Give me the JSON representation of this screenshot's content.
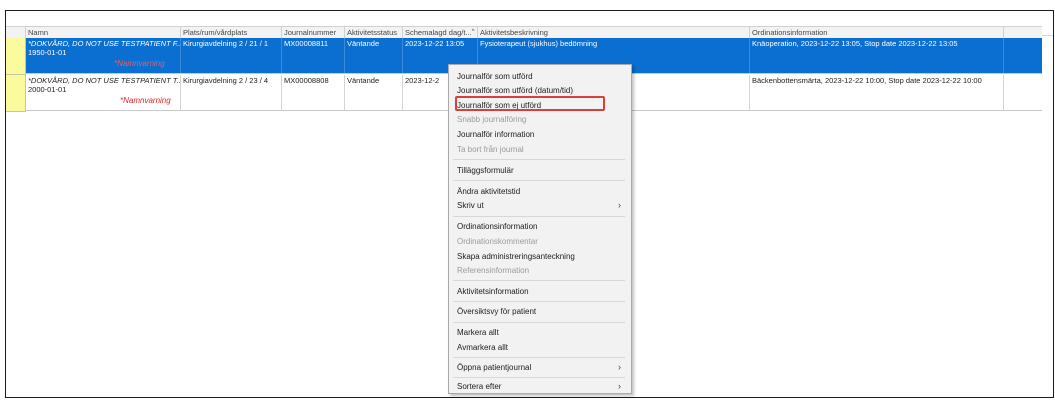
{
  "table": {
    "headers": [
      "Namn",
      "Plats/rum/vårdplats",
      "Journalnummer",
      "Aktivitetsstatus",
      "Schemalagd dag/t...",
      "Aktivitetsbeskrivning",
      "Ordinationsinformation"
    ],
    "sort_indicator": "^",
    "rows": [
      {
        "name": "*DOKVÅRD, DO NOT USE TESTPATIENT F...",
        "birthdate": "1950-01-01",
        "warning": "*Namnvarning",
        "location": "Kirurgiavdelning 2 / 21 / 1",
        "journal": "MX00008811",
        "status": "Väntande",
        "scheduled": "2023-12-22  13:05",
        "description": "Fysioterapeut (sjukhus) bedömning",
        "order": "Knäoperation, 2023-12-22 13:05, Stop date 2023-12-22 13:05"
      },
      {
        "name": "*DOKVÅRD, DO NOT USE TESTPATIENT T...",
        "birthdate": "2000-01-01",
        "warning": "*Namnvarning",
        "location": "Kirurgiavdelning 2 / 23 / 4",
        "journal": "MX00008808",
        "status": "Väntande",
        "scheduled": "2023-12-2",
        "description": "",
        "order": "Bäckenbottensmärta, 2023-12-22 10:00, Stop date 2023-12-22 10:00"
      }
    ]
  },
  "menu": {
    "items": [
      "Journalför som utförd",
      "Journalför som utförd (datum/tid)",
      "Journalför som ej utförd",
      "Snabb journalföring",
      "Journalför information",
      "Ta bort från journal",
      "Tilläggsformulär",
      "Ändra aktivitetstid",
      "Skriv ut",
      "Ordinationsinformation",
      "Ordinationskommentar",
      "Skapa administreringsanteckning",
      "Referensinformation",
      "Aktivitetsinformation",
      "Översiktsvy för patient",
      "Markera allt",
      "Avmarkera allt",
      "Öppna patientjournal",
      "Sortera efter"
    ],
    "submenu_arrow": "›"
  },
  "colors": {
    "selection": "#0b6fd1",
    "marker": "#fbfb9e",
    "warning_text": "#d8282a",
    "highlight_box": "#d9403a"
  }
}
